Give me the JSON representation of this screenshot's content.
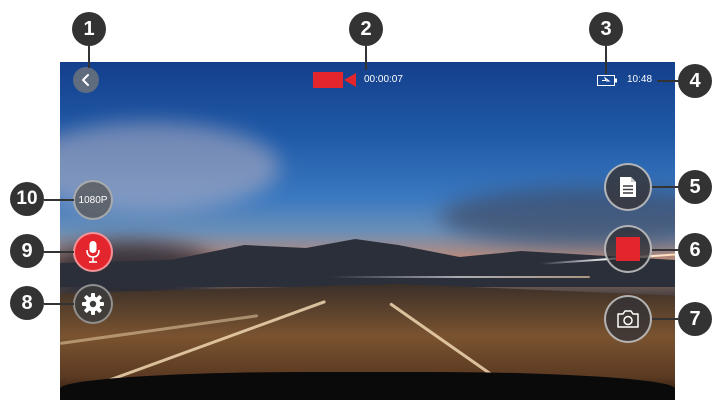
{
  "status_bar": {
    "back_icon": "chevron-left-icon",
    "record_icon": "video-camera-icon",
    "record_color": "#e3262e",
    "record_time": "00:00:07",
    "battery_icon": "battery-charging-icon",
    "clock": "10:48"
  },
  "left_controls": {
    "resolution_label": "1080P",
    "mic_icon": "microphone-icon",
    "settings_icon": "gear-icon"
  },
  "right_controls": {
    "files_icon": "document-icon",
    "stop_icon": "stop-icon",
    "snapshot_icon": "camera-icon"
  },
  "callouts": [
    "1",
    "2",
    "3",
    "4",
    "5",
    "6",
    "7",
    "8",
    "9",
    "10"
  ]
}
